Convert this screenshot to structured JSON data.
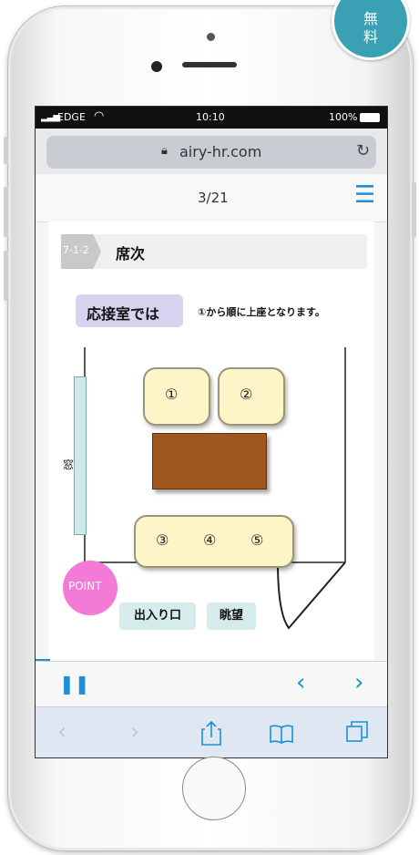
{
  "badge": {
    "line1": "無",
    "line2": "料"
  },
  "status": {
    "carrier": "EDGE",
    "time": "10:10",
    "battery": "100%"
  },
  "browser": {
    "url": "airy-hr.com",
    "reload_icon": "reload-icon",
    "lock_icon": "lock-icon"
  },
  "page_nav": {
    "page_indicator": "3/21",
    "menu_icon": "hamburger-menu-icon"
  },
  "slide": {
    "section_number": "7-1-2",
    "section_title": "席次",
    "room_label": "応接室では",
    "instruction": "①から順に上座となります。",
    "window_label": "窓",
    "seats": [
      "①",
      "②",
      "③",
      "④",
      "⑤"
    ],
    "point_label": "POINT",
    "entrance_label": "出入り口",
    "view_label": "眺望"
  },
  "toolbar": {
    "pause_icon": "pause-icon",
    "prev_icon": "chevron-left-icon",
    "next_icon": "chevron-right-icon"
  },
  "safari_toolbar": {
    "back_icon": "back-icon",
    "forward_icon": "forward-icon",
    "share_icon": "share-icon",
    "bookmarks_icon": "book-icon",
    "tabs_icon": "tabs-icon"
  },
  "colors": {
    "accent": "#1d8fd8",
    "badge": "#3aa0b4",
    "room_label_bg": "#d7d2f0",
    "point": "#f47ad8",
    "table": "#a0571f",
    "chair": "#fbf5c7",
    "window": "#cfe8ea"
  }
}
